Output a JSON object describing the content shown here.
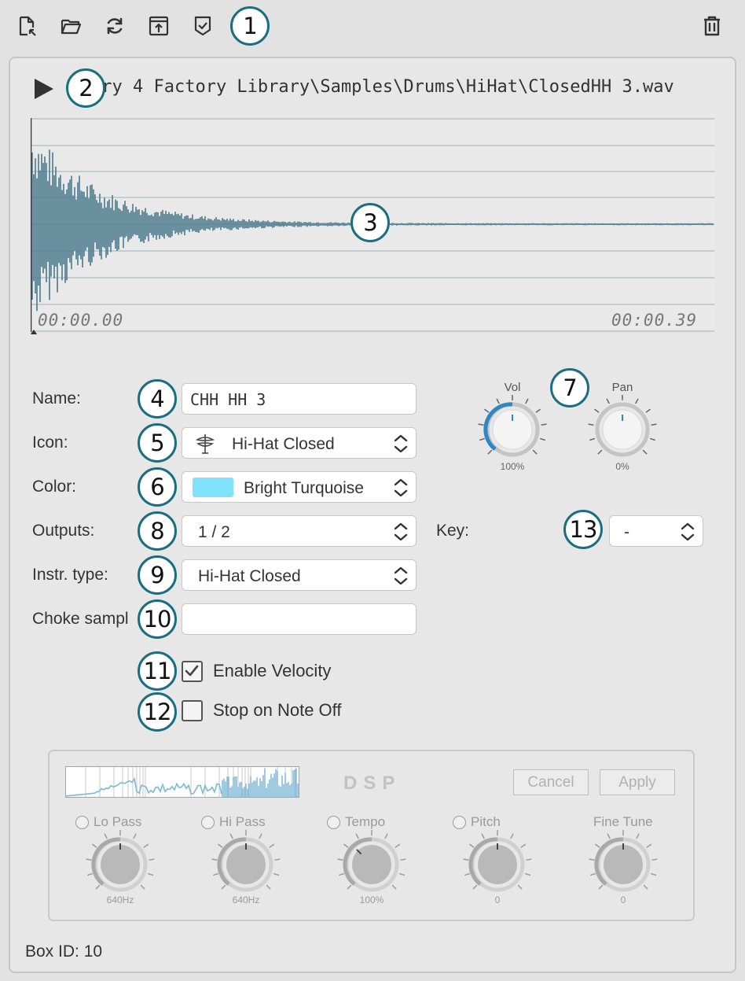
{
  "toolbar": {
    "items": [
      {
        "name": "new-file-icon"
      },
      {
        "name": "open-folder-icon"
      },
      {
        "name": "refresh-icon"
      },
      {
        "name": "export-icon"
      },
      {
        "name": "checkmark-shield-icon"
      }
    ],
    "delete": {
      "name": "trash-icon"
    }
  },
  "callouts": [
    "1",
    "2",
    "3",
    "4",
    "5",
    "6",
    "7",
    "8",
    "9",
    "10",
    "11",
    "12",
    "13"
  ],
  "sample": {
    "path": "ery 4 Factory Library\\Samples\\Drums\\HiHat\\ClosedHH 3.wav",
    "time_start": "00:00.00",
    "time_end": "00:00.39"
  },
  "form": {
    "name_label": "Name:",
    "name_value": "CHH HH 3",
    "icon_label": "Icon:",
    "icon_value": "Hi-Hat Closed",
    "color_label": "Color:",
    "color_value": "Bright Turquoise",
    "color_hex": "#7fe2fa",
    "outputs_label": "Outputs:",
    "outputs_value": "1 / 2",
    "instr_label": "Instr. type:",
    "instr_value": "Hi-Hat Closed",
    "choke_label": "Choke sampl",
    "choke_value": "",
    "key_label": "Key:",
    "key_value": "-"
  },
  "checkboxes": {
    "velocity_label": "Enable Velocity",
    "velocity_checked": true,
    "noteoff_label": "Stop on Note Off",
    "noteoff_checked": false
  },
  "knobs": {
    "vol_label": "Vol",
    "vol_value": "100%",
    "pan_label": "Pan",
    "pan_value": "0%"
  },
  "dsp": {
    "title": "DSP",
    "cancel_label": "Cancel",
    "apply_label": "Apply",
    "params": [
      {
        "label": "Lo Pass",
        "value": "640Hz"
      },
      {
        "label": "Hi Pass",
        "value": "640Hz"
      },
      {
        "label": "Tempo",
        "value": "100%"
      },
      {
        "label": "Pitch",
        "value": "0"
      },
      {
        "label": "Fine Tune",
        "value": "0"
      }
    ]
  },
  "footer": {
    "box_id": "Box ID: 10"
  },
  "colors": {
    "accent": "#1a6e80",
    "waveform": "#4a7a8e",
    "knob_arc": "#2f86c0"
  }
}
